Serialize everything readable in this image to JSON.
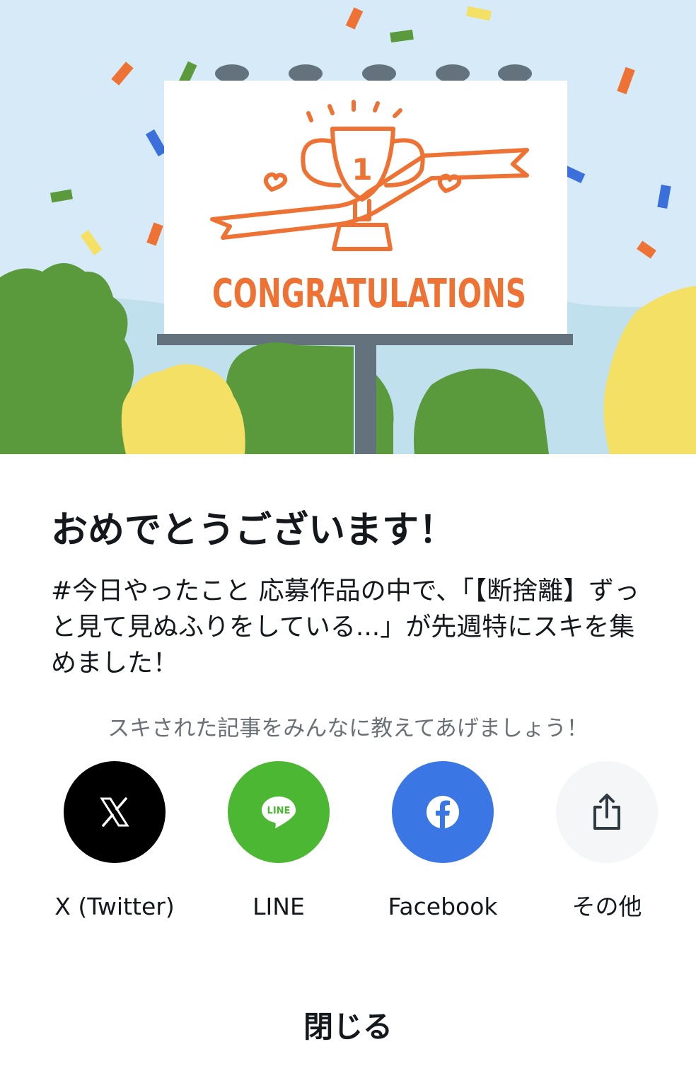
{
  "hero": {
    "billboard_text": "CONGRATULATIONS",
    "trophy_number": "1",
    "colors": {
      "sky": "#d6ebf7",
      "accent_orange": "#ee7233",
      "tree_green": "#5a9a3c",
      "tree_yellow": "#f3e064",
      "pole": "#63727d"
    }
  },
  "dialog": {
    "title": "おめでとうございます！",
    "message": "#今日やったこと 応募作品の中で、「【断捨離】ずっと見て見ぬふりをしている...」が先週特にスキを集めました！",
    "share_prompt": "スキされた記事をみんなに教えてあげましょう！",
    "share_options": [
      {
        "label": "X (Twitter)",
        "icon": "x-logo-icon",
        "color": "#000000"
      },
      {
        "label": "LINE",
        "icon": "line-logo-icon",
        "color": "#4cb732"
      },
      {
        "label": "Facebook",
        "icon": "facebook-logo-icon",
        "color": "#3a76e4"
      },
      {
        "label": "その他",
        "icon": "share-icon",
        "color": "#f4f6f7"
      }
    ],
    "close_label": "閉じる"
  }
}
